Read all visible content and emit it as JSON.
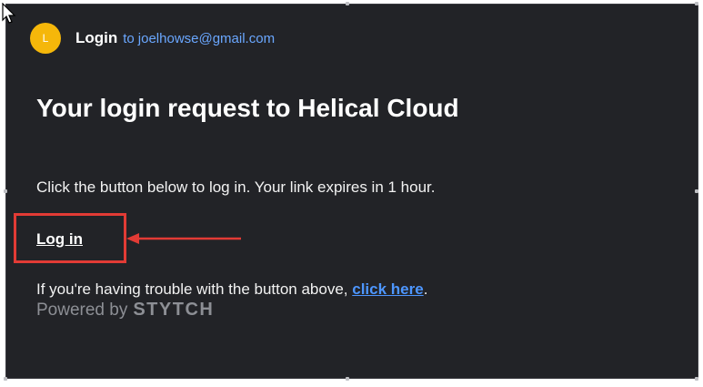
{
  "header": {
    "avatar_initial": "L",
    "sender": "Login",
    "recipient_prefix": "to",
    "recipient_email": "joelhowse@gmail.com"
  },
  "email": {
    "headline": "Your login request to Helical Cloud",
    "instructions": "Click the button below to log in. Your link expires in 1 hour.",
    "login_link": "Log in",
    "trouble_prefix": "If you're having trouble with the button above, ",
    "trouble_link": "click here",
    "trouble_suffix": ".",
    "powered_by": "Powered by",
    "powered_brand": "STYTCH"
  },
  "colors": {
    "background": "#222327",
    "avatar": "#f5b70a",
    "link": "#4d96ff",
    "email": "#6aa7ff",
    "annotation": "#e23b35"
  },
  "icons": {
    "cursor": "mouse-pointer-icon",
    "annotation_arrow": "arrow-left-icon"
  }
}
